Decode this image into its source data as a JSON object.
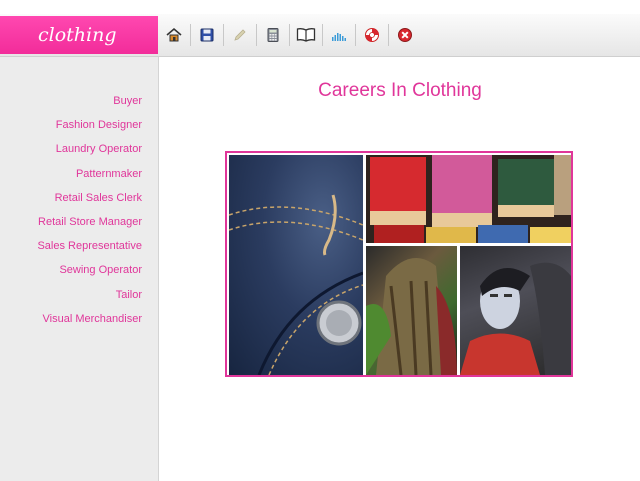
{
  "brand": {
    "label": "clothing"
  },
  "toolbar": {
    "buttons": [
      {
        "name": "home",
        "icon": "home-icon"
      },
      {
        "name": "save",
        "icon": "save-icon"
      },
      {
        "name": "edit",
        "icon": "pencil-icon"
      },
      {
        "name": "calculator",
        "icon": "calculator-icon"
      },
      {
        "name": "book",
        "icon": "book-icon"
      },
      {
        "name": "chart",
        "icon": "chart-icon"
      },
      {
        "name": "help",
        "icon": "lifebuoy-icon"
      },
      {
        "name": "close",
        "icon": "close-icon"
      }
    ]
  },
  "sidebar": {
    "items": [
      {
        "label": "Buyer"
      },
      {
        "label": "Fashion Designer"
      },
      {
        "label": "Laundry Operator"
      },
      {
        "label": "Patternmaker"
      },
      {
        "label": "Retail Sales Clerk"
      },
      {
        "label": "Retail Store Manager"
      },
      {
        "label": "Sales Representative"
      },
      {
        "label": "Sewing Operator"
      },
      {
        "label": "Tailor"
      },
      {
        "label": "Visual Merchandiser"
      }
    ]
  },
  "main": {
    "title": "Careers In Clothing"
  },
  "colors": {
    "accent": "#e0369a",
    "brand_bg": "#f63aa4",
    "sidebar_bg": "#ececec"
  }
}
